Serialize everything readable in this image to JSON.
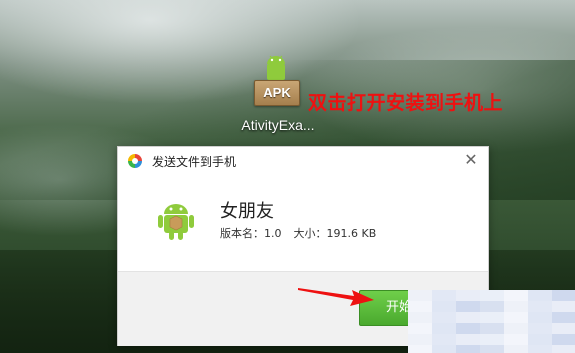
{
  "desktop": {
    "icon": {
      "badge": "APK",
      "label": "AtivityExa...",
      "icon_name": "apk-android-icon"
    },
    "annotation": "双击打开安装到手机上",
    "annotation_color": "#e11111"
  },
  "dialog": {
    "title": "发送文件到手机",
    "close_icon": "close-icon",
    "app": {
      "name": "女朋友",
      "version_label": "版本名：1.0",
      "size_label": "大小：191.6 KB",
      "icon_name": "android-icon"
    },
    "start_button_label": "开始",
    "button_color": "#4aa92e"
  }
}
